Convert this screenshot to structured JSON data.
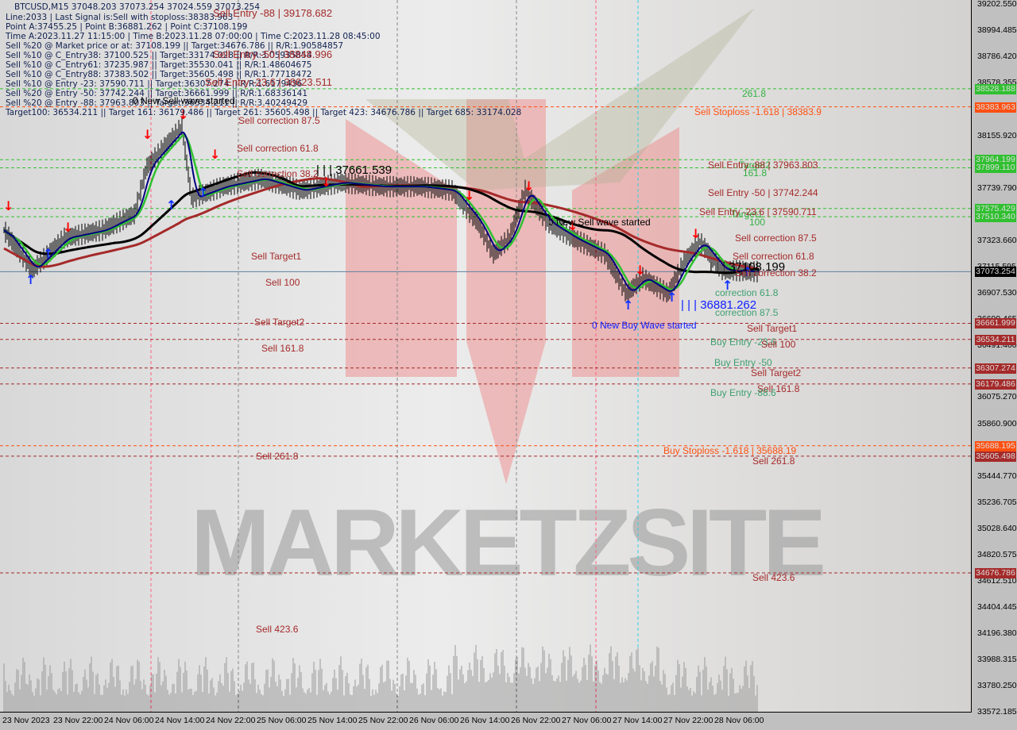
{
  "chart_data": {
    "type": "line",
    "symbol_header": "BTCUSD,M15  37048.203 37073.254 37024.559 37073.254",
    "info_lines": [
      "Line:2033 | Last Signal is:Sell with stoploss:38383.963",
      "Point A:37455.25 | Point B:36881.262 | Point C:37108.199",
      "Time A:2023.11.27 11:15:00 | Time B:2023.11.28 07:00:00 | Time C:2023.11.28 08:45:00",
      "Sell %20 @ Market price or at: 37108.199 || Target:34676.786 || R/R:1.90584857",
      "Sell %10 @ C_Entry38: 37100.525 || Target:33174.028 || R/R:3.05935854",
      "Sell %10 @ C_Entry61: 37235.987 || Target:35530.041 || R/R:1.48604675",
      "Sell %10 @ C_Entry88: 37383.502 || Target:35605.498 || R/R:1.77718472",
      "Sell %10 @ Entry -23: 37590.711 || Target:36307.274 || R/R:1.6179436",
      "Sell %20 @ Entry -50: 37742.244 || Target:36661.999 || R/R:1.68336141",
      "Sell %20 @ Entry -88: 37963.803 || Target:36534.211 || R/R:3.40249429",
      "Target100: 36534.211 || Target 161: 36179.486 || Target 261: 35605.498 || Target 423: 34676.786 || Target 685: 33174.028"
    ],
    "y_ticks": [
      "39202.550",
      "38994.485",
      "38786.420",
      "38578.355",
      "38155.920",
      "37739.790",
      "37323.660",
      "37115.595",
      "36907.530",
      "36699.465",
      "36491.400",
      "36283.335",
      "36075.270",
      "35860.900",
      "35444.770",
      "35236.705",
      "35028.640",
      "34820.575",
      "34612.510",
      "34404.445",
      "34196.380",
      "33988.315",
      "33780.250",
      "33572.185"
    ],
    "ylim": [
      33572.185,
      39202.55
    ],
    "x_ticks": [
      {
        "label": "23 Nov 2023",
        "t": "11-23 14:00"
      },
      {
        "label": "23 Nov 22:00",
        "t": "11-23 22:00"
      },
      {
        "label": "24 Nov 06:00",
        "t": "11-24 06:00"
      },
      {
        "label": "24 Nov 14:00",
        "t": "11-24 14:00"
      },
      {
        "label": "24 Nov 22:00",
        "t": "11-24 22:00"
      },
      {
        "label": "25 Nov 06:00",
        "t": "11-25 06:00"
      },
      {
        "label": "25 Nov 14:00",
        "t": "11-25 14:00"
      },
      {
        "label": "25 Nov 22:00",
        "t": "11-25 22:00"
      },
      {
        "label": "26 Nov 06:00",
        "t": "11-26 06:00"
      },
      {
        "label": "26 Nov 14:00",
        "t": "11-26 14:00"
      },
      {
        "label": "26 Nov 22:00",
        "t": "11-26 22:00"
      },
      {
        "label": "27 Nov 06:00",
        "t": "11-27 06:00"
      },
      {
        "label": "27 Nov 14:00",
        "t": "11-27 14:00"
      },
      {
        "label": "27 Nov 22:00",
        "t": "11-27 22:00"
      },
      {
        "label": "28 Nov 06:00",
        "t": "11-28 06:00"
      }
    ],
    "close": [
      [
        "11-23 14:00",
        37403
      ],
      [
        "11-23 18:30",
        37088
      ],
      [
        "11-23 23:30",
        37340
      ],
      [
        "11-24 05:30",
        37403
      ],
      [
        "11-24 10:30",
        37530
      ],
      [
        "11-24 12:30",
        37908
      ],
      [
        "11-24 18:00",
        38224
      ],
      [
        "11-24 19:30",
        37656
      ],
      [
        "11-25 00:30",
        37750
      ],
      [
        "11-25 06:30",
        37813
      ],
      [
        "11-25 12:45",
        37719
      ],
      [
        "11-25 19:00",
        37782
      ],
      [
        "11-26 01:30",
        37750
      ],
      [
        "11-26 07:30",
        37750
      ],
      [
        "11-26 12:30",
        37719
      ],
      [
        "11-26 16:30",
        37467
      ],
      [
        "11-26 19:00",
        37214
      ],
      [
        "11-26 21:30",
        37340
      ],
      [
        "11-27 00:00",
        37719
      ],
      [
        "11-27 03:30",
        37467
      ],
      [
        "11-27 07:30",
        37340
      ],
      [
        "11-27 12:30",
        37214
      ],
      [
        "11-27 16:00",
        36898
      ],
      [
        "11-27 18:30",
        37024
      ],
      [
        "11-27 22:30",
        36898
      ],
      [
        "11-28 01:00",
        37151
      ],
      [
        "11-28 03:30",
        37309
      ],
      [
        "11-28 07:00",
        37088
      ],
      [
        "11-28 12:00",
        37073
      ]
    ],
    "current_price": {
      "value": 37073.254,
      "label": "37073.254",
      "color": "#000000"
    },
    "levels": [
      {
        "price": 38528.188,
        "tag": "38528.188",
        "color": "#30c030"
      },
      {
        "price": 38383.963,
        "tag": "38383.963",
        "color": "#ff5010"
      },
      {
        "price": 37964.199,
        "tag": "37964.199",
        "color": "#30c030"
      },
      {
        "price": 37899.11,
        "tag": "37899.110",
        "color": "#30c030"
      },
      {
        "price": 37575.429,
        "tag": "37575.429",
        "color": "#30c030"
      },
      {
        "price": 37510.34,
        "tag": "37510.340",
        "color": "#30c030"
      },
      {
        "price": 36661.999,
        "tag": "36661.999",
        "color": "#a52a2a"
      },
      {
        "price": 36534.211,
        "tag": "36534.211",
        "color": "#a52a2a"
      },
      {
        "price": 36307.274,
        "tag": "36307.274",
        "color": "#a52a2a"
      },
      {
        "price": 36179.486,
        "tag": "36179.486",
        "color": "#a52a2a"
      },
      {
        "price": 35688.195,
        "tag": "35688.195",
        "color": "#ff5010"
      },
      {
        "price": 35605.498,
        "tag": "35605.498",
        "color": "#a52a2a"
      },
      {
        "price": 34676.786,
        "tag": "34676.786",
        "color": "#a52a2a"
      }
    ],
    "annotations": {
      "sell_entry_88_top": "Sell Entry -88 | 39178.682",
      "sell_entry_50_top": "Sell Entry -50 | 38848.996",
      "sell_entry_23_top": "Sell Entry -23.6 | 38623.511",
      "new_sell_wave_1": "0 New Sell wave started",
      "sell_corr_875_l": "Sell correction 87.5",
      "sell_corr_618_l": "Sell correction 61.8",
      "sell_corr_382_l": "Sell correction 38.2",
      "point_a": "| | | 37661.539",
      "sell_target1_l": "Sell Target1",
      "sell_100_l": "Sell 100",
      "sell_target2_l": "Sell Target2",
      "sell_1618_l": "Sell 161.8",
      "sell_2618_l": "Sell  261.8",
      "sell_4236_l": "Sell  423.6",
      "fib_2618": "261.8",
      "sell_stoploss": "Sell Stoploss -1.618 | 38383.9",
      "target2": "Target2",
      "fib_1618": "161.8",
      "sell_entry_88": "Sell Entry -88 | 37963.803",
      "sell_entry_50": "Sell Entry -50 | 37742.244",
      "sell_entry_23": "Sell Entry -23.6 | 37590.711",
      "target1": "Target1",
      "fib_100": "100",
      "new_sell_wave_2": "0 New Sell wave started",
      "sell_corr_875_r": "Sell correction 87.5",
      "sell_corr_618_r": "Sell correction 61.8",
      "sell_corr_382_r": "Sell correction 38.2",
      "point_c": "| | | 37108.199",
      "corr_618": "correction 61.8",
      "corr_875": "correction 87.5",
      "point_b": "| | | 36881.262",
      "new_buy_wave": "0 New Buy Wave started",
      "sell_target1_r": "Sell Target1",
      "buy_entry_23": "Buy Entry -23.6",
      "sell_100_r": "Sell 100",
      "buy_entry_50": "Buy Entry -50",
      "sell_target2_r": "Sell Target2",
      "sell_1618_r": "Sell 161.8",
      "buy_entry_88": "Buy Entry -88.6",
      "buy_stoploss": "Buy Stoploss -1.618 | 35688.19",
      "sell_2618_r": "Sell  261.8",
      "sell_4236_r": "Sell  423.6"
    },
    "watermark": "MARKETZSITE",
    "colors": {
      "ma_slow": "#a52a2a",
      "ma_mid": "#000000",
      "ma_fast": "#000080",
      "ma_green": "#30c030",
      "sell_arrow": "#ff0000",
      "buy_arrow": "#1030ff"
    }
  }
}
